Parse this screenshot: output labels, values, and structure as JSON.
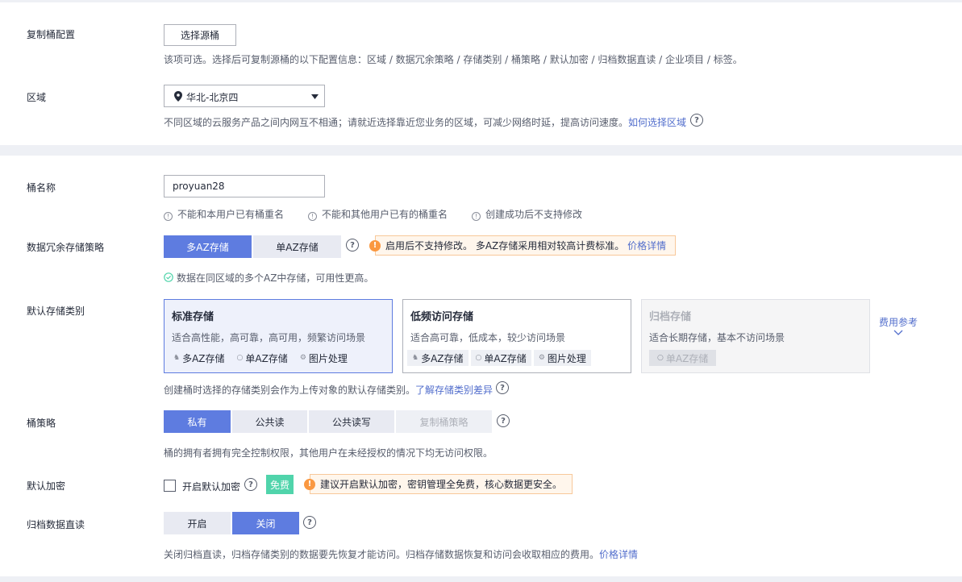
{
  "replicate": {
    "label": "复制桶配置",
    "button": "选择源桶",
    "hint": "该项可选。选择后可复制源桶的以下配置信息：区域 / 数据冗余策略 / 存储类别 / 桶策略 / 默认加密 / 归档数据直读 / 企业项目 / 标签。"
  },
  "region": {
    "label": "区域",
    "value": "华北-北京四",
    "hint": "不同区域的云服务产品之间内网互不相通；请就近选择靠近您业务的区域，可减少网络时延，提高访问速度。",
    "link": "如何选择区域"
  },
  "bucket_name": {
    "label": "桶名称",
    "value": "proyuan28",
    "rules": [
      "不能和本用户已有桶重名",
      "不能和其他用户已有的桶重名",
      "创建成功后不支持修改"
    ]
  },
  "redundancy": {
    "label": "数据冗余存储策略",
    "options": [
      "多AZ存储",
      "单AZ存储"
    ],
    "selected": "多AZ存储",
    "warn_text": "启用后不支持修改。 多AZ存储采用相对较高计费标准。",
    "warn_link": "价格详情",
    "success": "数据在同区域的多个AZ中存储，可用性更高。"
  },
  "storage_class": {
    "label": "默认存储类别",
    "cards": [
      {
        "title": "标准存储",
        "desc": "适合高性能，高可靠，高可用，频繁访问场景",
        "tags": [
          "多AZ存储",
          "单AZ存储",
          "图片处理"
        ]
      },
      {
        "title": "低频访问存储",
        "desc": "适合高可靠，低成本，较少访问场景",
        "tags": [
          "多AZ存储",
          "单AZ存储",
          "图片处理"
        ]
      },
      {
        "title": "归档存储",
        "desc": "适合长期存储，基本不访问场景",
        "tags": [
          "单AZ存储"
        ]
      }
    ],
    "fee_ref": "费用参考",
    "hint": "创建桶时选择的存储类别会作为上传对象的默认存储类别。",
    "link": "了解存储类别差异"
  },
  "policy": {
    "label": "桶策略",
    "options": [
      "私有",
      "公共读",
      "公共读写",
      "复制桶策略"
    ],
    "selected": "私有",
    "hint": "桶的拥有者拥有完全控制权限，其他用户在未经授权的情况下均无访问权限。"
  },
  "encryption": {
    "label": "默认加密",
    "checkbox": "开启默认加密",
    "badge": "免费",
    "warn_text": "建议开启默认加密，密钥管理全免费，核心数据更安全。"
  },
  "archive_read": {
    "label": "归档数据直读",
    "options": [
      "开启",
      "关闭"
    ],
    "selected": "关闭",
    "hint": "关闭归档直读，归档存储类别的数据要先恢复才能访问。归档存储数据恢复和访问会收取相应的费用。",
    "link": "价格详情"
  },
  "colors": {
    "accent": "#5e7ce0",
    "link": "#526ecc",
    "warning": "#fa9841",
    "success": "#50d4ab",
    "page_bg": "#eef0f5"
  }
}
